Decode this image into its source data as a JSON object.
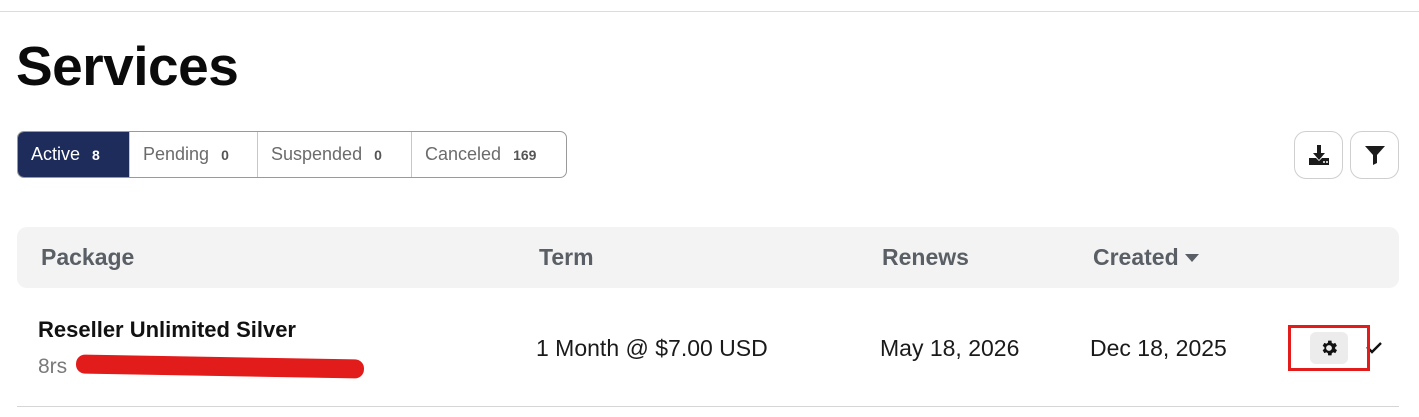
{
  "page": {
    "title": "Services"
  },
  "status_tabs": [
    {
      "label": "Active",
      "count": "8",
      "selected": true
    },
    {
      "label": "Pending",
      "count": "0",
      "selected": false
    },
    {
      "label": "Suspended",
      "count": "0",
      "selected": false
    },
    {
      "label": "Canceled",
      "count": "169",
      "selected": false
    }
  ],
  "toolbar": {
    "download_icon": "download-icon",
    "filter_icon": "filter-icon"
  },
  "table": {
    "columns": {
      "package": "Package",
      "term": "Term",
      "renews": "Renews",
      "created": "Created"
    },
    "sort": {
      "column": "Created",
      "direction": "descending"
    },
    "rows": [
      {
        "package_name": "Reseller Unlimited Silver",
        "domain_visible_prefix": "8rs",
        "term": "1 Month @ $7.00 USD",
        "renews": "May 18, 2026",
        "created": "Dec 18, 2025",
        "actions": [
          "gear-icon",
          "chevron-down-icon"
        ]
      }
    ]
  },
  "colors": {
    "active_tab_bg": "#1e2c5c",
    "header_bg": "#f3f3f3",
    "annotation_red": "#e21b1b"
  }
}
